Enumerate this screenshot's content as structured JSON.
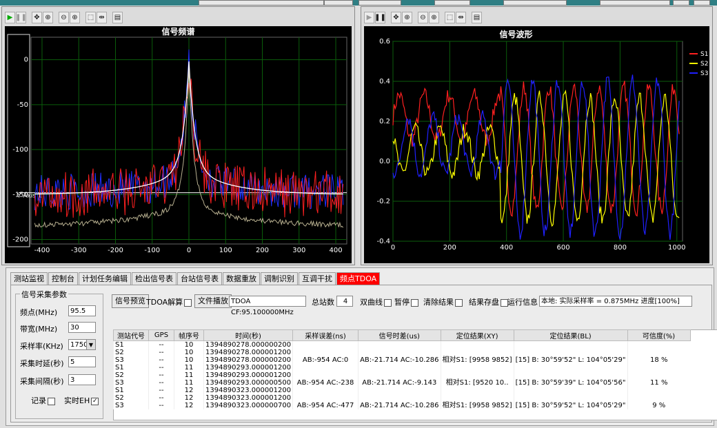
{
  "left_chart": {
    "title": "信号频谱",
    "yaxis_title": "Y Axis 1",
    "x_ticks": [
      "-400",
      "-300",
      "-200",
      "-100",
      "0",
      "100",
      "200",
      "300",
      "400"
    ],
    "y_ticks": [
      "0",
      "-50",
      "-100",
      "-150",
      "-200"
    ]
  },
  "right_chart": {
    "title": "信号波形",
    "x_ticks": [
      "0",
      "200",
      "400",
      "600",
      "800",
      "1000"
    ],
    "y_ticks": [
      "0.6",
      "0.4",
      "0.2",
      "0.0",
      "-0.2",
      "-0.4"
    ],
    "legend": [
      {
        "name": "S1",
        "color": "#ff2020"
      },
      {
        "name": "S2",
        "color": "#ffff00"
      },
      {
        "name": "S3",
        "color": "#2020ff"
      }
    ]
  },
  "chart_data": [
    {
      "type": "line",
      "title": "信号频谱",
      "ylabel": "Y Axis 1",
      "xlim": [
        -430,
        430
      ],
      "ylim": [
        -205,
        25
      ],
      "series": []
    },
    {
      "type": "line",
      "title": "信号波形",
      "xlim": [
        0,
        1020
      ],
      "ylim": [
        -0.4,
        0.6
      ],
      "series": [
        {
          "name": "S1"
        },
        {
          "name": "S2"
        },
        {
          "name": "S3"
        }
      ]
    }
  ],
  "tabs": [
    "测站监视",
    "控制台",
    "计划任务编辑",
    "检出信号表",
    "台站信号表",
    "数据重放",
    "调制识别",
    "互调干扰",
    "频点TDOA"
  ],
  "params": {
    "title": "信号采集参数",
    "center_freq_label": "频点(MHz)",
    "center_freq_value": "95.5",
    "bandwidth_label": "带宽(MHz)",
    "bandwidth_value": "30",
    "sample_rate_label": "采样率(KHz)",
    "sample_rate_value": "1750",
    "delay_label": "采集时延(秒)",
    "delay_value": "5",
    "interval_label": "采集间隔(秒)",
    "interval_value": "3",
    "record_label": "记录",
    "realtime_label": "实时EH"
  },
  "actions": {
    "preview": "信号预览",
    "tdoa_solve": "TDOA解算",
    "file_play": "文件播放",
    "file_name": "TDOA CF:95.100000MHz",
    "station_count_label": "总站数",
    "station_count_value": "4",
    "dual_curve": "双曲线",
    "pause": "暂停",
    "clear_result": "清除结果",
    "save_result": "结果存盘",
    "run_info": "运行信息",
    "status": "本地: 实际采样率 = 0.875MHz 进度[100%]"
  },
  "table": {
    "headers": [
      "测站代号",
      "GPS",
      "帧序号",
      "时间(秒)",
      "采样误差(ns)",
      "信号时差(us)",
      "定位结果(XY)",
      "定位结果(BL)",
      "可信度(%)"
    ],
    "rows": [
      [
        "S1",
        "--",
        "10",
        "1394890278.000000200",
        "",
        "",
        "",
        "",
        ""
      ],
      [
        "S2",
        "--",
        "10",
        "1394890278.000001200",
        "",
        "",
        "",
        "",
        ""
      ],
      [
        "S3",
        "--",
        "10",
        "1394890278.000000200",
        "AB:-954 AC:0",
        "AB:-21.714 AC:-10.286",
        "相对S1: [9958 9852]",
        "[15] B: 30°59'52\" L: 104°05'29\"",
        "18 %"
      ],
      [
        "S1",
        "--",
        "11",
        "1394890293.000001200",
        "",
        "",
        "",
        "",
        ""
      ],
      [
        "S2",
        "--",
        "11",
        "1394890293.000001200",
        "",
        "",
        "",
        "",
        ""
      ],
      [
        "S3",
        "--",
        "11",
        "1394890293.000000500",
        "AB:-954 AC:-238",
        "AB:-21.714 AC:-9.143",
        "相对S1: [9520 10..",
        "[15] B: 30°59'39\" L: 104°05'56\"",
        "11 %"
      ],
      [
        "S1",
        "--",
        "12",
        "1394890323.000001200",
        "",
        "",
        "",
        "",
        ""
      ],
      [
        "S2",
        "--",
        "12",
        "1394890323.000001200",
        "",
        "",
        "",
        "",
        ""
      ],
      [
        "S3",
        "--",
        "12",
        "1394890323.000000700",
        "AB:-954 AC:-477",
        "AB:-21.714 AC:-10.286",
        "相对S1: [9958 9852]",
        "[15] B: 30°59'52\" L: 104°05'29\"",
        "9 %"
      ]
    ]
  }
}
